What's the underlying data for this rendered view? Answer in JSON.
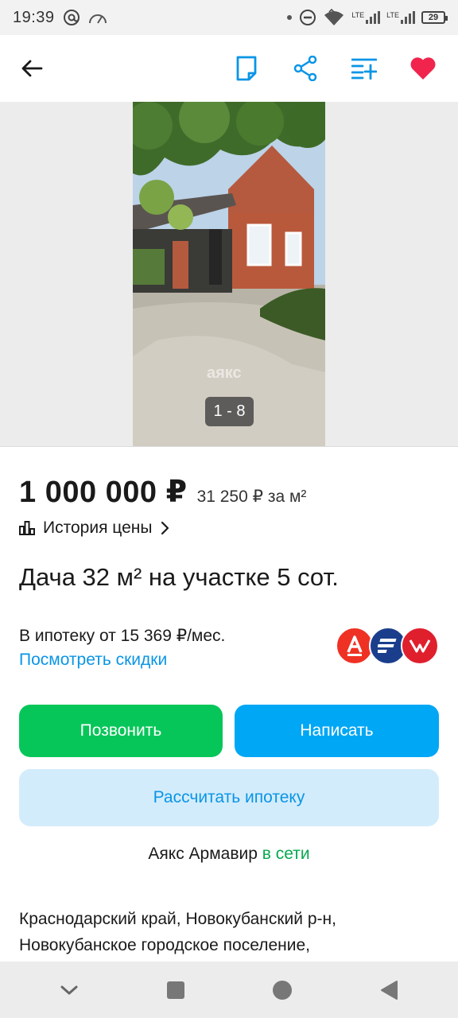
{
  "status_bar": {
    "time": "19:39",
    "battery": "29",
    "icons": [
      "at-icon",
      "speedometer-icon",
      "dot-icon",
      "dnd-icon",
      "wifi-icon",
      "lte-signal-icon",
      "lte-signal-icon",
      "battery-icon"
    ],
    "lte1": "LTE",
    "lte2": "LTE"
  },
  "toolbar": {
    "icons": [
      "back-arrow-icon",
      "note-icon",
      "share-icon",
      "compare-list-icon",
      "heart-icon"
    ],
    "accent": "#0a95e6",
    "favorite_color": "#f0244d"
  },
  "gallery": {
    "counter": "1 - 8",
    "watermark": "аякс"
  },
  "listing": {
    "price": "1 000 000 ₽",
    "price_per_m": "31 250 ₽ за м²",
    "history_label": "История цены",
    "title": "Дача 32 м² на участке 5 сот.",
    "mortgage_text": "В ипотеку от 15 369 ₽/мес.",
    "discount_link": "Посмотреть скидки",
    "banks": [
      "alfa-bank-logo",
      "bank-logo-blue",
      "bank-logo-red"
    ]
  },
  "buttons": {
    "call": "Позвонить",
    "write": "Написать",
    "calc_mortgage": "Рассчитать ипотеку"
  },
  "agency": {
    "name": "Аякс Армавир",
    "status": "в сети"
  },
  "address": {
    "line1": "Краснодарский край, Новокубанский р-н,",
    "line2": "Новокубанское городское поселение,"
  },
  "nav_bar": {
    "icons": [
      "chevron-down-icon",
      "square-icon",
      "circle-icon",
      "triangle-back-icon"
    ]
  },
  "colors": {
    "green": "#07c659",
    "blue": "#00a7f5",
    "light_blue": "#d3ecfb",
    "link": "#0a95e6"
  }
}
